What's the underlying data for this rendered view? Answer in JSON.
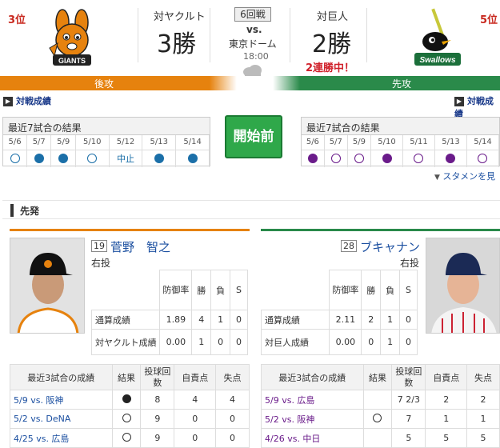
{
  "header": {
    "left_rank": "3位",
    "right_rank": "5位",
    "left_vs": "対ヤクルト",
    "left_wins": "3勝",
    "game_no": "6回戦",
    "vs": "vs.",
    "venue": "東京ドーム",
    "time": "18:00",
    "right_vs": "対巨人",
    "right_wins": "2勝",
    "streak": "2連勝中！",
    "left_side": "後攻",
    "right_side": "先攻",
    "left_logo_text": "GIANTS",
    "right_logo_text": "Swallows"
  },
  "links": {
    "left": "対戦成績",
    "right": "対戦成績"
  },
  "recent_left": {
    "title": "最近7試合の結果",
    "dates": [
      "5/6",
      "5/7",
      "5/9",
      "5/10",
      "5/12",
      "5/13",
      "5/14"
    ],
    "results": [
      "open",
      "blue",
      "blue",
      "open",
      "中止",
      "blue",
      "blue"
    ]
  },
  "recent_right": {
    "title": "最近7試合の結果",
    "dates": [
      "5/6",
      "5/7",
      "5/9",
      "5/10",
      "5/11",
      "5/13",
      "5/14"
    ],
    "results": [
      "purp",
      "popen",
      "popen",
      "purp",
      "popen",
      "purp",
      "popen"
    ]
  },
  "start_button": "開始前",
  "lineup_link": "スタメンを見",
  "section_title": "先発",
  "pitcher_left": {
    "number": "19",
    "name": "菅野　智之",
    "hand": "右投"
  },
  "pitcher_right": {
    "number": "28",
    "name": "ブキャナン",
    "hand": "右投"
  },
  "stat_headers": {
    "era": "防御率",
    "win": "勝",
    "loss": "負",
    "save": "S"
  },
  "stats_left": [
    {
      "label": "通算成績",
      "era": "1.89",
      "w": "4",
      "l": "1",
      "s": "0"
    },
    {
      "label": "対ヤクルト成績",
      "era": "0.00",
      "w": "1",
      "l": "0",
      "s": "0"
    }
  ],
  "stats_right": [
    {
      "label": "通算成績",
      "era": "2.11",
      "w": "2",
      "l": "1",
      "s": "0"
    },
    {
      "label": "対巨人成績",
      "era": "0.00",
      "w": "0",
      "l": "1",
      "s": "0"
    }
  ],
  "game_headers": {
    "title": "最近3試合の成績",
    "result": "結果",
    "innings": "投球回数",
    "er": "自責点",
    "runs": "失点"
  },
  "games_left": [
    {
      "game": "5/9 vs. 阪神",
      "result": "filled",
      "ip": "8",
      "er": "4",
      "r": "4"
    },
    {
      "game": "5/2 vs. DeNA",
      "result": "open",
      "ip": "9",
      "er": "0",
      "r": "0"
    },
    {
      "game": "4/25 vs. 広島",
      "result": "open",
      "ip": "9",
      "er": "0",
      "r": "0"
    }
  ],
  "games_right": [
    {
      "game": "5/9 vs. 広島",
      "result": "",
      "ip": "7 2/3",
      "er": "2",
      "r": "2"
    },
    {
      "game": "5/2 vs. 阪神",
      "result": "open",
      "ip": "7",
      "er": "1",
      "r": "1"
    },
    {
      "game": "4/26 vs. 中日",
      "result": "",
      "ip": "5",
      "er": "5",
      "r": "5"
    }
  ]
}
